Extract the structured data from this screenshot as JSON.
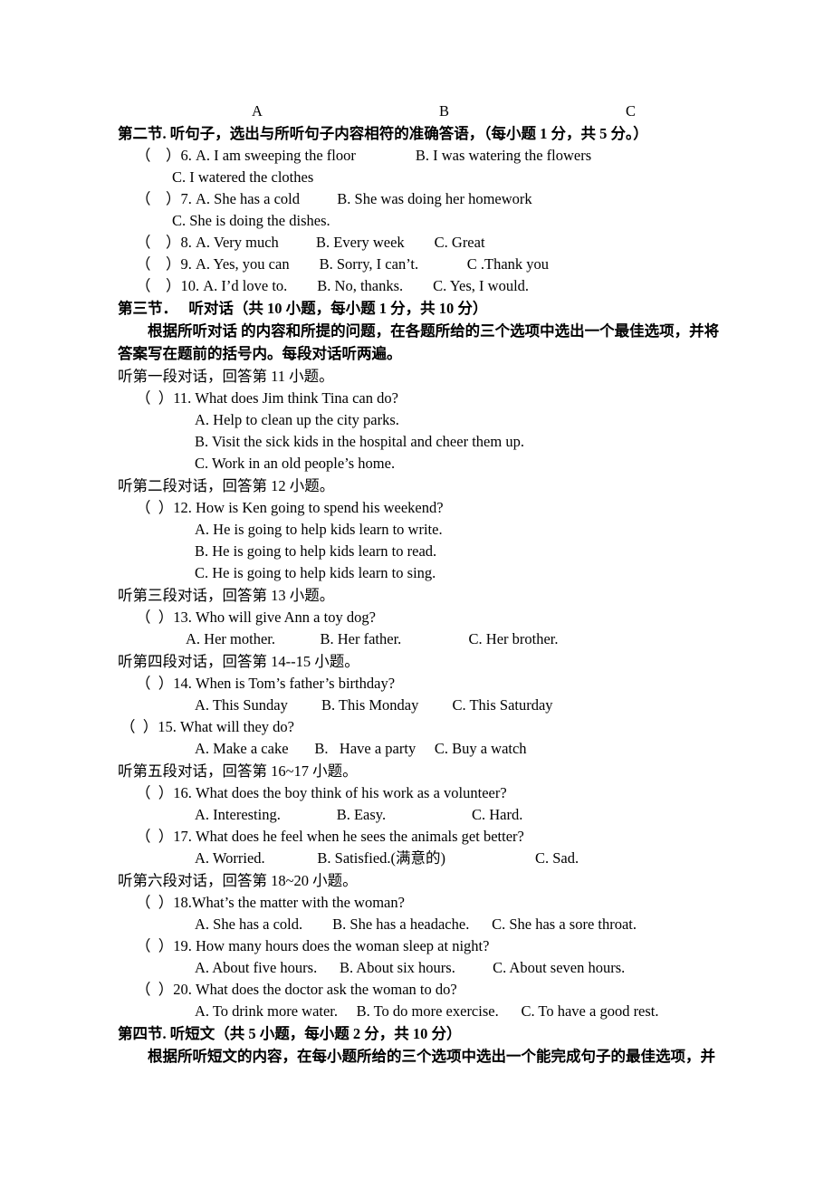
{
  "document": {
    "language": "zh-CN/en",
    "type": "english-listening-exam-paper"
  },
  "abc_header": {
    "a": "A",
    "b": "B",
    "c": "C"
  },
  "section_two": {
    "heading": "第二节. 听句子，选出与所听句子内容相符的准确答语，（每小题 1 分，共 5 分。）",
    "questions": [
      {
        "line1": "（    ）6. A. I am sweeping the floor                B. I was watering the flowers",
        "line2": "C. I watered the clothes"
      },
      {
        "line1": "（    ）7. A. She has a cold          B. She was doing her homework",
        "line2": "C. She is doing the dishes."
      },
      {
        "line1": "（    ）8. A. Very much          B. Every week        C. Great"
      },
      {
        "line1": "（    ）9. A. Yes, you can        B. Sorry, I can’t.             C .Thank you"
      },
      {
        "line1": "（    ）10. A. I’d love to.        B. No, thanks.        C. Yes, I would."
      }
    ]
  },
  "section_three": {
    "heading": "第三节．   听对话（共 10 小题，每小题 1 分，共 10 分）",
    "instruction_line1": "根据所听对话 的内容和所提的问题，在各题所给的三个选项中选出一个最佳选项，并将",
    "instruction_line2": "答案写在题前的括号内。每段对话听两遍。",
    "dialogues": [
      {
        "cue": "听第一段对话，回答第 11 小题。",
        "items": [
          {
            "stem": "（  ）11. What does Jim think Tina can do?",
            "options": [
              "A. Help to clean up the city parks.",
              "B. Visit the sick kids in the hospital and cheer them up.",
              "C. Work in an old people’s home."
            ]
          }
        ]
      },
      {
        "cue": "听第二段对话，回答第 12 小题。",
        "items": [
          {
            "stem": "（  ）12. How is Ken going to spend his weekend?",
            "options": [
              "A. He is going to help kids learn to write.",
              "B. He is going to help kids learn to read.",
              "C. He is going to help kids learn to sing."
            ]
          }
        ]
      },
      {
        "cue": "听第三段对话，回答第 13 小题。",
        "items": [
          {
            "stem": "（  ）13. Who will give Ann a toy dog?",
            "options_inline": "A. Her mother.            B. Her father.                  C. Her brother."
          }
        ]
      },
      {
        "cue": "听第四段对话，回答第 14--15 小题。",
        "items": [
          {
            "stem": "（  ）14. When is Tom’s father’s birthday?",
            "options_inline": "A. This Sunday         B. This Monday         C. This Saturday"
          },
          {
            "stem": "（  ）15. What will they do?",
            "options_inline": "A. Make a cake       B.   Have a party     C. Buy a watch"
          }
        ]
      },
      {
        "cue": "听第五段对话，回答第 16~17 小题。",
        "items": [
          {
            "stem": "（  ）16. What does the boy think of his work as a volunteer?",
            "options_inline": "A. Interesting.               B. Easy.                       C. Hard."
          },
          {
            "stem": "（  ）17. What does he feel when he sees the animals get better?",
            "options_inline": "A. Worried.              B. Satisfied.(满意的)                        C. Sad."
          }
        ]
      },
      {
        "cue": "听第六段对话，回答第 18~20 小题。",
        "items": [
          {
            "stem": "（  ）18.What’s the matter with the woman?",
            "options_inline": "A. She has a cold.        B. She has a headache.      C. She has a sore throat."
          },
          {
            "stem": "（  ）19. How many hours does the woman sleep at night?",
            "options_inline": "A. About five hours.      B. About six hours.          C. About seven hours."
          },
          {
            "stem": "（  ）20. What does the doctor ask the woman to do?",
            "options_inline": "A. To drink more water.     B. To do more exercise.      C. To have a good rest."
          }
        ]
      }
    ]
  },
  "section_four": {
    "heading": "第四节. 听短文（共 5 小题，每小题 2 分，共 10 分）",
    "instruction_line1": "根据所听短文的内容，在每小题所给的三个选项中选出一个能完成句子的最佳选项，并"
  }
}
